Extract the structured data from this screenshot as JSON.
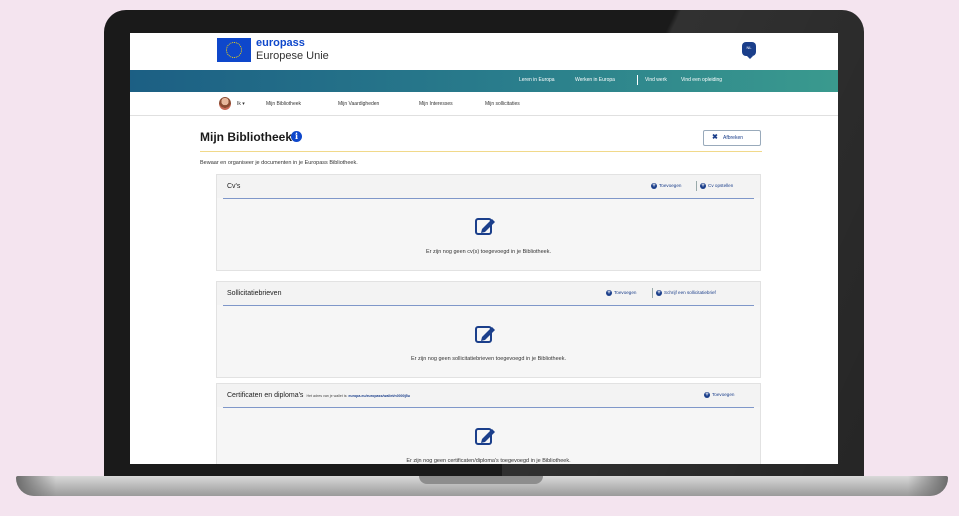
{
  "brand": {
    "line1": "europass",
    "line2": "Europese Unie",
    "lang_badge": "NL"
  },
  "topnav": {
    "items": [
      "Leren in Europa",
      "Werken in Europa",
      "Vind werk",
      "Vind een opleiding"
    ]
  },
  "mainnav": {
    "user": "Ik",
    "items": [
      "Mijn Bibliotheek",
      "Mijn Vaardigheden",
      "Mijn Interesses",
      "Mijn sollicitaties"
    ]
  },
  "page": {
    "title": "Mijn Bibliotheek",
    "cancel_label": "Afbreken",
    "intro": "Bewaar en organiseer je documenten in je Europass Bibliotheek."
  },
  "sections": [
    {
      "title": "Cv's",
      "actions": [
        "Toevoegen",
        "Cv opstellen"
      ],
      "empty": "Er zijn nog geen cv(s) toegevoegd in je Bibliotheek."
    },
    {
      "title": "Sollicitatiebrieven",
      "actions": [
        "Toevoegen",
        "Schrijf een sollicitatiebrief"
      ],
      "empty": "Er zijn nog geen sollicitatiebrieven toegevoegd in je Bibliotheek."
    },
    {
      "title": "Certificaten en diploma's",
      "subtitle_prefix": "Het adres van je wallet is:",
      "subtitle_link": "europa.eu/europass/wallet/n0000j5u",
      "actions": [
        "Toevoegen"
      ],
      "empty": "Er zijn nog geen certificaten/diploma's toegevoegd in je Bibliotheek."
    }
  ],
  "colors": {
    "brand_blue": "#0e47cb",
    "link_blue": "#1b3f8b",
    "bar_teal": "#2a7e8c",
    "background_pink": "#f4e4ef"
  }
}
